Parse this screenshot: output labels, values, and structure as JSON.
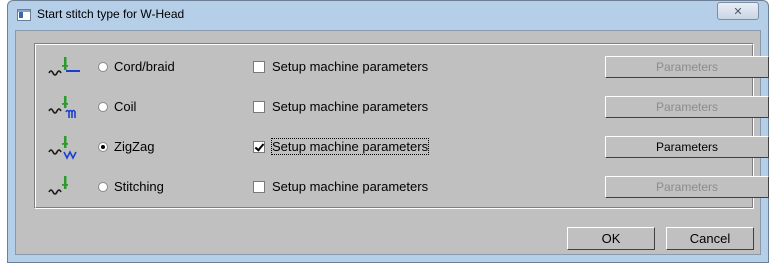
{
  "window": {
    "title": "Start stitch type for W-Head",
    "close_glyph": "✕"
  },
  "rows": [
    {
      "label": "Cord/braid",
      "icon": "cord-braid-stitch-icon",
      "selected": false,
      "setup_label": "Setup machine parameters",
      "setup_checked": false,
      "params_label": "Parameters",
      "params_enabled": false
    },
    {
      "label": "Coil",
      "icon": "coil-stitch-icon",
      "selected": false,
      "setup_label": "Setup machine parameters",
      "setup_checked": false,
      "params_label": "Parameters",
      "params_enabled": false
    },
    {
      "label": "ZigZag",
      "icon": "zigzag-stitch-icon",
      "selected": true,
      "setup_label": "Setup machine parameters",
      "setup_checked": true,
      "params_label": "Parameters",
      "params_enabled": true
    },
    {
      "label": "Stitching",
      "icon": "stitching-stitch-icon",
      "selected": false,
      "setup_label": "Setup machine parameters",
      "setup_checked": false,
      "params_label": "Parameters",
      "params_enabled": false
    }
  ],
  "buttons": {
    "ok": "OK",
    "cancel": "Cancel"
  },
  "colors": {
    "frame": "#b6cfe8",
    "dialog_bg": "#c0c0c0",
    "icon_green": "#2e9a2e",
    "icon_blue": "#1a3fd0",
    "disabled_text": "#8c8c8c"
  }
}
